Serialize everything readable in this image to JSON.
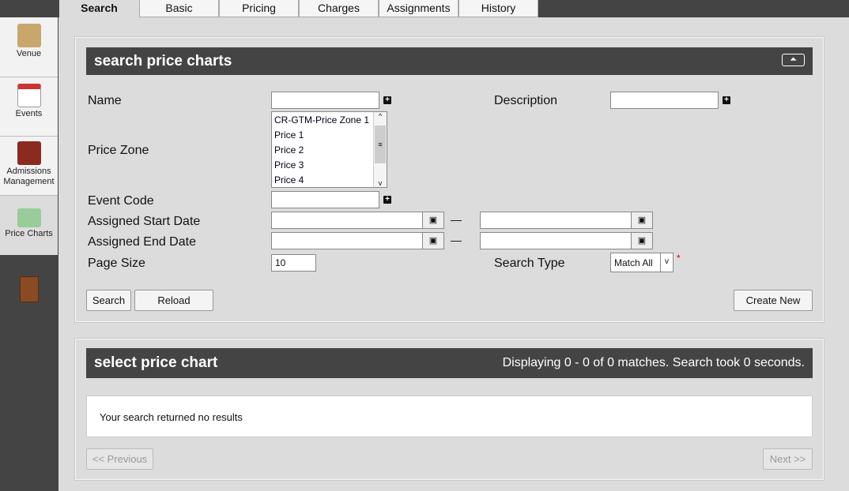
{
  "tabs": [
    {
      "label": "Search",
      "active": true
    },
    {
      "label": "Basic"
    },
    {
      "label": "Pricing"
    },
    {
      "label": "Charges"
    },
    {
      "label": "Assignments"
    },
    {
      "label": "History"
    }
  ],
  "sidebar": {
    "items": [
      {
        "label": "Venue",
        "icon": "venue-icon"
      },
      {
        "label": "Events",
        "icon": "calendar-icon"
      },
      {
        "label": "Admissions Management",
        "icon": "admissions-icon"
      },
      {
        "label": "Price Charts",
        "icon": "price-chart-icon",
        "selected": true
      }
    ],
    "exit_icon": "exit-door-icon"
  },
  "search": {
    "title": "search price charts",
    "labels": {
      "name": "Name",
      "description": "Description",
      "price_zone": "Price Zone",
      "event_code": "Event Code",
      "start": "Assigned Start Date",
      "end": "Assigned End Date",
      "page_size": "Page Size",
      "search_type": "Search Type"
    },
    "price_zones": [
      "CR-GTM-Price Zone 1",
      "Price 1",
      "Price 2",
      "Price 3",
      "Price 4"
    ],
    "page_size": "10",
    "search_type": "Match All",
    "required_mark": "*",
    "dash": "—",
    "buttons": {
      "search": "Search",
      "reload": "Reload",
      "create": "Create New"
    }
  },
  "results": {
    "title": "select price chart",
    "status": "Displaying 0 - 0 of 0 matches. Search took 0 seconds.",
    "empty": "Your search returned no results",
    "prev": "<< Previous",
    "next": "Next >>"
  }
}
